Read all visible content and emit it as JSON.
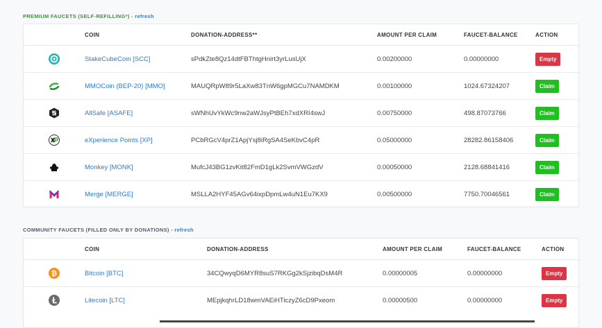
{
  "premium": {
    "title": "PREMIUM FAUCETS (SELF-REFILLING*)",
    "sep": " - ",
    "refresh": "refresh",
    "headers": {
      "coin": "COIN",
      "address": "DONATION-ADDRESS**",
      "amount": "AMOUNT PER CLAIM",
      "balance": "FAUCET-BALANCE",
      "action": "ACTION"
    },
    "rows": [
      {
        "icon": "stakecubecoin-icon",
        "coin": "StakeCubeCoin [SCC]",
        "address": "sPdkZte8Qz14dtFBThtgHnirt3yrLusUjX",
        "amount": "0.00200000",
        "balance": "0.00000000",
        "action": "Empty"
      },
      {
        "icon": "mmocoin-icon",
        "coin": "MMOCoin (BEP-20) [MMO]",
        "address": "MAUQRpW89r5LaXw83TnW6gpMGCu7NAMDKM",
        "amount": "0.00100000",
        "balance": "1024.67324207",
        "action": "Claim"
      },
      {
        "icon": "allsafe-icon",
        "coin": "AllSafe [ASAFE]",
        "address": "sWNhUvYkWc9nw2aWJsyPtBEh7xdXRI4swJ",
        "amount": "0.00750000",
        "balance": "498.87073766",
        "action": "Claim"
      },
      {
        "icon": "experience-points-icon",
        "coin": "eXperience Points [XP]",
        "address": "PCbRGcV4prZ1ApjYsj8iRgSA4SeKbvC4pR",
        "amount": "0.05000000",
        "balance": "28282.86158406",
        "action": "Claim"
      },
      {
        "icon": "monkey-icon",
        "coin": "Monkey [MONK]",
        "address": "MufcJ43BG1zvKit82FmD1gLk2SvmVWGzdV",
        "amount": "0.00050000",
        "balance": "2128.68841416",
        "action": "Claim"
      },
      {
        "icon": "merge-icon",
        "coin": "Merge [MERGE]",
        "address": "MSLLA2HYF45AGv64ixpDpmLw4uN1Eu7KX9",
        "amount": "0.00500000",
        "balance": "7750.70046561",
        "action": "Claim"
      }
    ]
  },
  "community": {
    "title": "COMMUNITY FAUCETS (FILLED ONLY BY DONATIONS)",
    "sep": " - ",
    "refresh": "refresh",
    "headers": {
      "coin": "COIN",
      "address": "DONATION-ADDRESS",
      "amount": "AMOUNT PER CLAIM",
      "balance": "FAUCET-BALANCE",
      "action": "ACTION"
    },
    "rows": [
      {
        "icon": "bitcoin-icon",
        "coin": "Bitcoin [BTC]",
        "address": "34CQwyqD6MYR8suS7RKGg2kSjzibqDsM4R",
        "amount": "0.00000005",
        "balance": "0.00000000",
        "action": "Empty"
      },
      {
        "icon": "litecoin-icon",
        "coin": "Litecoin [LTC]",
        "address": "MEpjkqhrLD18wmVAEiHTiczyZ6cD9Pxeom",
        "amount": "0.00000500",
        "balance": "0.00000000",
        "action": "Empty"
      }
    ]
  },
  "colors": {
    "empty": "#dc3545",
    "claim": "#1fbf1f",
    "link": "#2e7ad1",
    "premium_title": "#2e9e2e"
  }
}
